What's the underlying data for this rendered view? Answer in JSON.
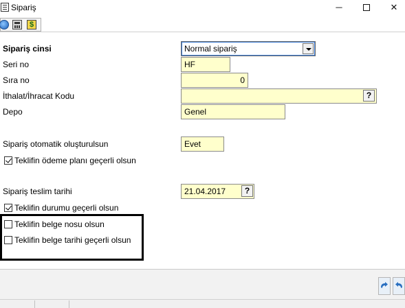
{
  "window": {
    "title": "Sipariş",
    "minimize_glyph": "─",
    "close_glyph": "✕"
  },
  "toolbar": {
    "icons": [
      "help-icon",
      "calculator-icon",
      "money-icon"
    ],
    "money_glyph": "$"
  },
  "form": {
    "order_type": {
      "label": "Sipariş cinsi",
      "value": "Normal sipariş"
    },
    "serial_no": {
      "label": "Seri no",
      "value": "HF"
    },
    "sequence_no": {
      "label": "Sıra no",
      "value": "0"
    },
    "import_export_code": {
      "label": "İthalat/İhracat Kodu",
      "value": "",
      "lookup": "?"
    },
    "warehouse": {
      "label": "Depo",
      "value": "Genel"
    },
    "auto_create": {
      "label": "Sipariş otomatik oluşturulsun",
      "value": "Evet"
    },
    "offer_payment_plan": {
      "label": "Teklifin ödeme planı geçerli olsun",
      "checked": true
    },
    "delivery_date": {
      "label": "Sipariş teslim tarihi",
      "value": "21.04.2017",
      "lookup": "?"
    },
    "offer_status": {
      "label": "Teklifin durumu geçerli olsun",
      "checked": true
    },
    "offer_doc_no": {
      "label": "Teklifin belge nosu olsun",
      "checked": false
    },
    "offer_doc_date": {
      "label": "Teklifin belge tarihi geçerli olsun",
      "checked": false
    }
  },
  "colors": {
    "field_bg": "#ffffcc",
    "focus_border": "#3a7bd5",
    "highlight_border": "#000000"
  }
}
